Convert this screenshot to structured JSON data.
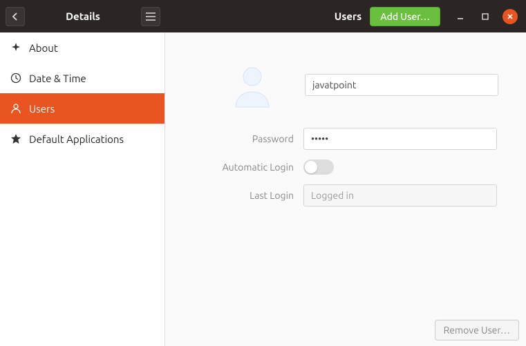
{
  "header": {
    "left_title": "Details",
    "right_title": "Users",
    "add_user_label": "Add User…"
  },
  "sidebar": {
    "items": [
      {
        "label": "About"
      },
      {
        "label": "Date & Time"
      },
      {
        "label": "Users"
      },
      {
        "label": "Default Applications"
      }
    ]
  },
  "user": {
    "name": "javatpoint",
    "password_label": "Password",
    "password_mask": "•••••",
    "auto_login_label": "Automatic Login",
    "last_login_label": "Last Login",
    "last_login_value": "Logged in"
  },
  "footer": {
    "remove_label": "Remove User…"
  }
}
